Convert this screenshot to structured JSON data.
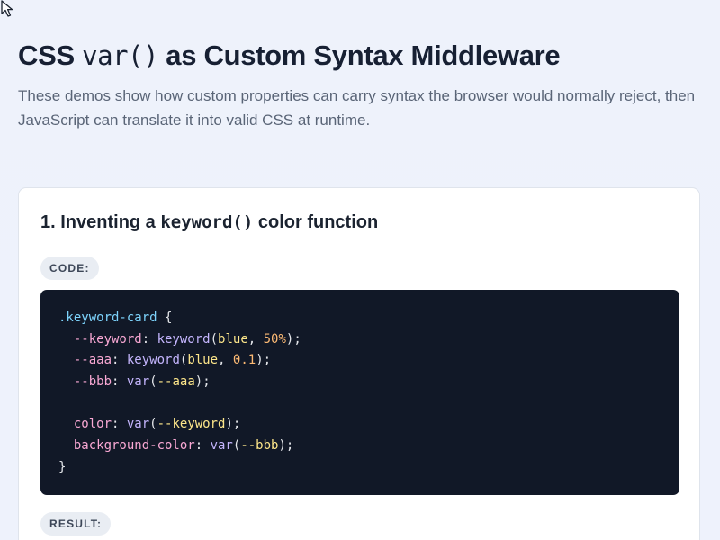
{
  "header": {
    "title_before": "CSS ",
    "title_code": "var()",
    "title_after": " as Custom Syntax Middleware",
    "intro": "These demos show how custom properties can carry syntax the browser would normally reject, then JavaScript can translate it into valid CSS at runtime."
  },
  "section1": {
    "title_before": "1. Inventing a ",
    "title_code": "keyword()",
    "title_after": " color function",
    "code_label": "CODE:",
    "result_label": "RESULT:",
    "code": {
      "selector": ".keyword-card",
      "open_brace": " {",
      "close_brace": "}",
      "l1_prop": "--keyword",
      "l1_fn": "keyword",
      "l1_arg1": "blue",
      "l1_arg2": "50%",
      "l2_prop": "--aaa",
      "l2_fn": "keyword",
      "l2_arg1": "blue",
      "l2_arg2": "0.1",
      "l3_prop": "--bbb",
      "l3_fn": "var",
      "l3_arg": "--aaa",
      "l4_prop": "color",
      "l4_fn": "var",
      "l4_arg": "--keyword",
      "l5_prop": "background-color",
      "l5_fn": "var",
      "l5_arg": "--bbb"
    }
  },
  "icons": {
    "cursor": "mouse-pointer-icon"
  }
}
